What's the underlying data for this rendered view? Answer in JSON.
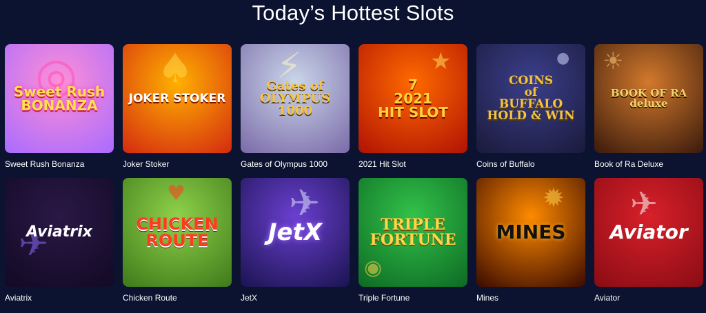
{
  "page": {
    "heading": "Today’s Hottest Slots"
  },
  "games": [
    {
      "name": "Sweet Rush Bonanza",
      "art_text": "Sweet Rush\nBONANZA",
      "icon": "lollipop-icon",
      "colors": {
        "bg1": "#ff8fd6",
        "bg2": "#a86bff",
        "text": "#ffe14a"
      }
    },
    {
      "name": "Joker Stoker",
      "art_text": "JOKER STOKER",
      "icon": "joker-icon",
      "colors": {
        "bg1": "#ffb100",
        "bg2": "#d42a10",
        "text": "#ffffff"
      }
    },
    {
      "name": "Gates of Olympus 1000",
      "art_text": "Gates of\nOLYMPUS\n1000",
      "icon": "zeus-icon",
      "colors": {
        "bg1": "#c9d6ea",
        "bg2": "#7b6aa8",
        "text": "#f6c445"
      }
    },
    {
      "name": "2021 Hit Slot",
      "art_text": "7\n2021\nHIT SLOT",
      "icon": "seven-icon",
      "colors": {
        "bg1": "#ff6a00",
        "bg2": "#b01204",
        "text": "#ffd23a"
      }
    },
    {
      "name": "Coins of Buffalo",
      "art_text": "COINS\nof\nBUFFALO\nHOLD & WIN",
      "icon": "buffalo-icon",
      "colors": {
        "bg1": "#3b3f8c",
        "bg2": "#1a1a3a",
        "text": "#f4c542"
      }
    },
    {
      "name": "Book of Ra Deluxe",
      "art_text": "BOOK OF RA\ndeluxe",
      "icon": "explorer-icon",
      "colors": {
        "bg1": "#d2792c",
        "bg2": "#3a1a0c",
        "text": "#f2d26a"
      }
    },
    {
      "name": "Aviatrix",
      "art_text": "Aviatrix",
      "icon": "jet-plane-icon",
      "colors": {
        "bg1": "#2a1846",
        "bg2": "#120a24",
        "text": "#ffffff"
      }
    },
    {
      "name": "Chicken Route",
      "art_text": "CHICKEN\nROUTE",
      "icon": "chicken-icon",
      "colors": {
        "bg1": "#8fd14a",
        "bg2": "#3e7a1a",
        "text": "#ff3b1f"
      }
    },
    {
      "name": "JetX",
      "art_text": "JetX",
      "icon": "jet-icon",
      "colors": {
        "bg1": "#6b3fd1",
        "bg2": "#1a1450",
        "text": "#ffffff"
      }
    },
    {
      "name": "Triple Fortune",
      "art_text": "TRIPLE\nFORTUNE",
      "icon": "coin-icon",
      "colors": {
        "bg1": "#33c24a",
        "bg2": "#0d6a24",
        "text": "#ffd54a"
      }
    },
    {
      "name": "Mines",
      "art_text": "MINES",
      "icon": "bomb-icon",
      "colors": {
        "bg1": "#ff8a00",
        "bg2": "#3a0a00",
        "text": "#1a1a1a"
      }
    },
    {
      "name": "Aviator",
      "art_text": "Aviator",
      "icon": "propeller-plane-icon",
      "colors": {
        "bg1": "#d8202a",
        "bg2": "#8a0c14",
        "text": "#ffffff"
      }
    }
  ]
}
